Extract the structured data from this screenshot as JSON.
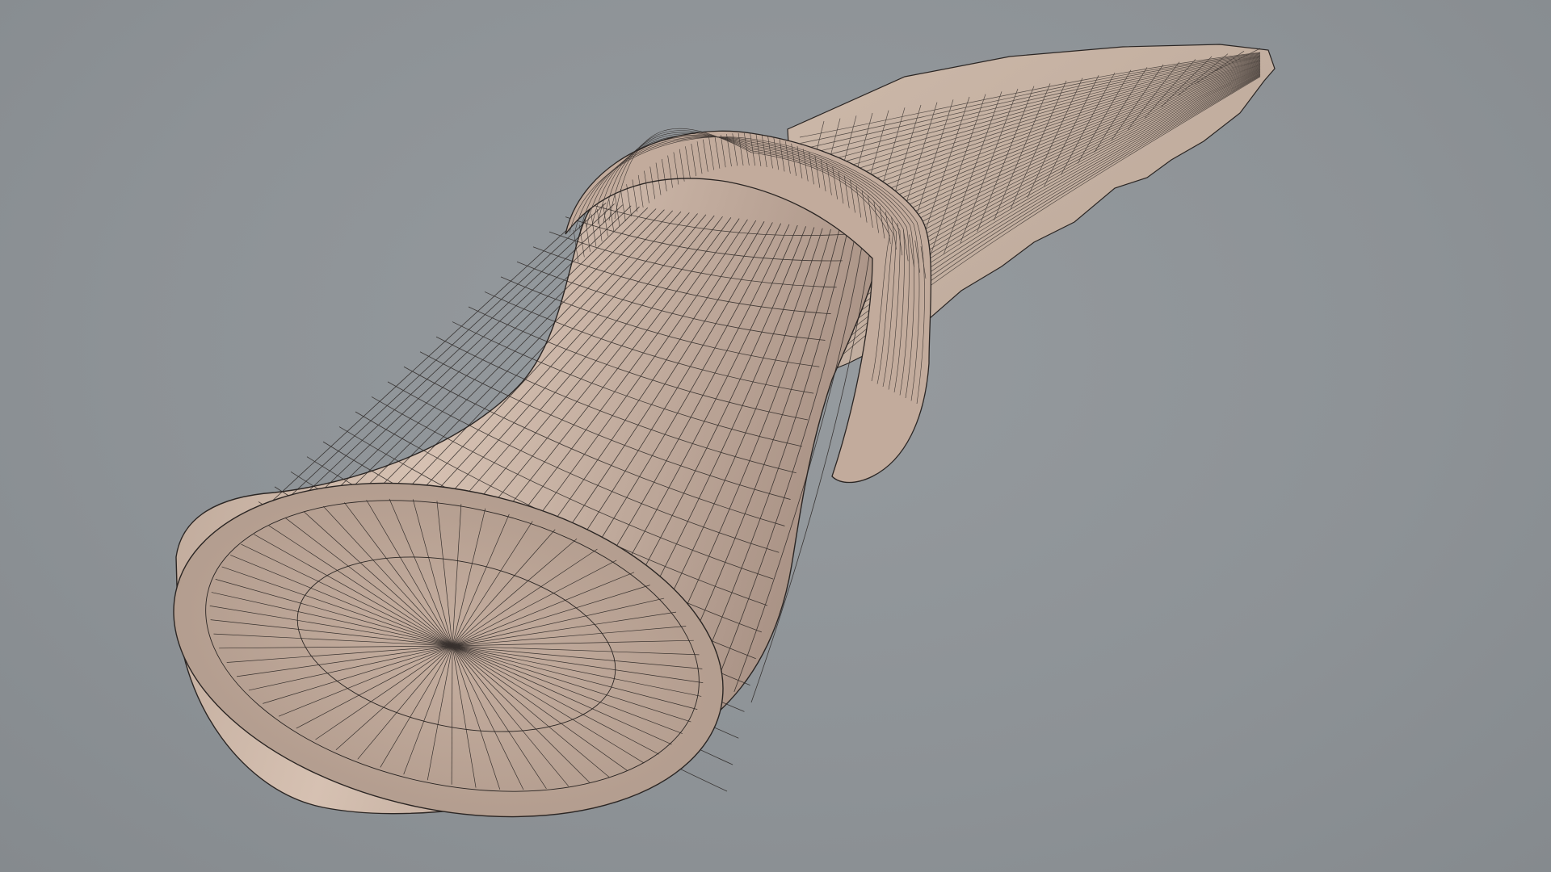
{
  "scene": {
    "background_color": "#8e9397",
    "mesh_fill": "#c9b3a4",
    "mesh_fill_dark": "#a89285",
    "wire_color": "#2a2523",
    "objects": [
      "handle-mesh",
      "lashing-mesh",
      "blade-mesh"
    ]
  }
}
